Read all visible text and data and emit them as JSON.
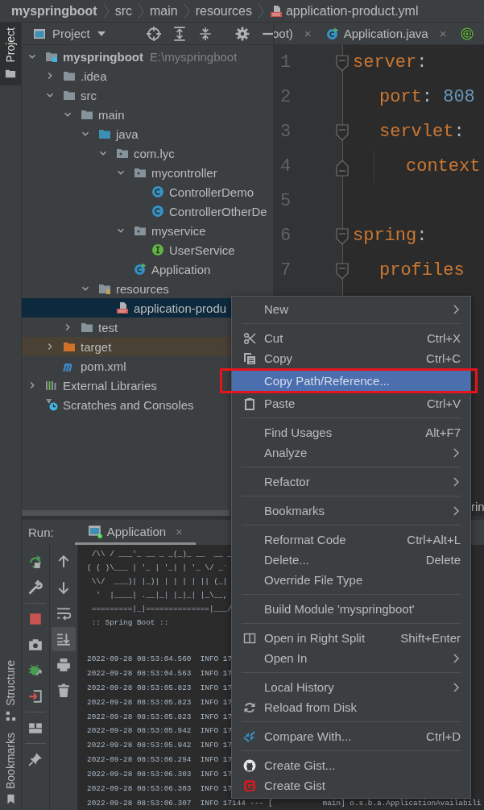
{
  "breadcrumbs": [
    {
      "label": "myspringboot",
      "kind": "project"
    },
    {
      "label": "src",
      "kind": "folder"
    },
    {
      "label": "main",
      "kind": "folder"
    },
    {
      "label": "resources",
      "kind": "folder"
    },
    {
      "label": "application-product.yml",
      "kind": "yml"
    }
  ],
  "tool_strip": {
    "top": [
      {
        "label": "Project",
        "selected": true
      }
    ],
    "bottom": [
      {
        "label": "Structure",
        "kind": "structure"
      },
      {
        "label": "Bookmarks",
        "kind": "bookmarks"
      }
    ]
  },
  "project_panel": {
    "title": "Project",
    "tree": [
      {
        "label": "myspringboot",
        "kind": "module",
        "hint": "E:\\myspringboot",
        "expanded": true,
        "selected": false,
        "children": [
          {
            "label": ".idea",
            "kind": "folder",
            "expanded": false,
            "selected": false
          },
          {
            "label": "src",
            "kind": "folder",
            "expanded": true,
            "selected": false,
            "children": [
              {
                "label": "main",
                "kind": "folder",
                "expanded": true,
                "selected": false,
                "children": [
                  {
                    "label": "java",
                    "kind": "source-folder",
                    "expanded": true,
                    "selected": false,
                    "children": [
                      {
                        "label": "com.lyc",
                        "kind": "package",
                        "expanded": true,
                        "selected": false,
                        "children": [
                          {
                            "label": "mycontroller",
                            "kind": "package",
                            "expanded": true,
                            "selected": false,
                            "children": [
                              {
                                "label": "ControllerDemo",
                                "kind": "class",
                                "selected": false
                              },
                              {
                                "label": "ControllerOtherDe",
                                "kind": "class",
                                "selected": false
                              }
                            ]
                          },
                          {
                            "label": "myservice",
                            "kind": "package",
                            "expanded": true,
                            "selected": false,
                            "children": [
                              {
                                "label": "UserService",
                                "kind": "interface",
                                "selected": false
                              }
                            ]
                          },
                          {
                            "label": "Application",
                            "kind": "main-class",
                            "selected": false
                          }
                        ]
                      }
                    ]
                  },
                  {
                    "label": "resources",
                    "kind": "resource-folder",
                    "expanded": true,
                    "selected": false,
                    "children": [
                      {
                        "label": "application-produ",
                        "kind": "yml",
                        "selected": true
                      }
                    ]
                  }
                ]
              },
              {
                "label": "test",
                "kind": "folder",
                "expanded": false,
                "selected": false
              }
            ]
          },
          {
            "label": "target",
            "kind": "excluded-folder",
            "expanded": false,
            "selected": false
          },
          {
            "label": "pom.xml",
            "kind": "maven",
            "selected": false
          }
        ]
      },
      {
        "label": "External Libraries",
        "kind": "libraries",
        "expanded": false,
        "selected": false
      },
      {
        "label": "Scratches and Consoles",
        "kind": "scratches",
        "selected": false
      }
    ]
  },
  "editor": {
    "tabs": [
      {
        "label": "oot)",
        "kind": "plain",
        "close": "×"
      },
      {
        "label": "Application.java",
        "kind": "main-class",
        "close": "×"
      },
      {
        "kind": "annotation"
      }
    ],
    "lines": [
      {
        "number": "1",
        "kind": "fold-start",
        "key": "server",
        "colon": ":",
        "children": [
          {
            "number": "2",
            "kind": "plain",
            "key": "port",
            "colon": ":",
            "value": "808"
          },
          {
            "number": "3",
            "kind": "fold-start",
            "key": "servlet",
            "colon": ":",
            "children": [
              {
                "number": "4",
                "kind": "fold-end",
                "key": "context"
              }
            ]
          }
        ]
      },
      {
        "number": "5",
        "kind": "plain"
      },
      {
        "number": "6",
        "kind": "fold-start",
        "key": "spring",
        "colon": ":",
        "children": [
          {
            "number": "7",
            "kind": "fold-start",
            "key": "profiles"
          }
        ]
      }
    ]
  },
  "side_fragment": "rin",
  "run_panel": {
    "title": "Run:",
    "tab": {
      "label": "Application",
      "close": "×",
      "selected": true
    },
    "tools_left": [
      {
        "kind": "rerun"
      },
      {
        "kind": "wrench"
      },
      {
        "kind": "separator"
      },
      {
        "kind": "stop"
      },
      {
        "kind": "camera"
      },
      {
        "kind": "bug"
      },
      {
        "kind": "exit"
      },
      {
        "kind": "separator"
      },
      {
        "kind": "layout"
      },
      {
        "kind": "separator"
      },
      {
        "kind": "pin"
      }
    ],
    "tools_right": [
      {
        "kind": "up",
        "on": false
      },
      {
        "kind": "down",
        "on": false
      },
      {
        "kind": "wrap",
        "on": false
      },
      {
        "kind": "scroll-end",
        "on": true
      },
      {
        "kind": "print",
        "on": false
      },
      {
        "kind": "trash",
        "on": false
      }
    ],
    "banner": [
      " /\\\\ / ___'_ __ _ _(_)_ __  __ _",
      "( ( )\\___ | '_ | '_| | '_ \\/ _`",
      " \\\\/  ___)| |_)| | | | | || (_|",
      "  '  |____| .__|_| |_|_| |_\\__,",
      " =========|_|==============|___/",
      " :: Spring Boot ::"
    ],
    "log": [
      "2022-09-28 08:53:04.560  INFO 17",
      "2022-09-28 08:53:04.563  INFO 17",
      "2022-09-28 08:53:05.823  INFO 17",
      "2022-09-28 08:53:05.823  INFO 17",
      "2022-09-28 08:53:05.823  INFO 17",
      "2022-09-28 08:53:05.942  INFO 17",
      "2022-09-28 08:53:05.942  INFO 17",
      "2022-09-28 08:53:06.294  INFO 17",
      "2022-09-28 08:53:06.303  INFO 17",
      "2022-09-28 08:53:06.303  INFO 17",
      "2022-09-28 08:53:06.307  INFO 17144 --- [           main] o.s.b.a.ApplicationAvailabili"
    ]
  },
  "context_menu": {
    "entries": [
      {
        "kind": "item",
        "label": "New",
        "submenu": true,
        "selected": false,
        "marked": false
      },
      {
        "kind": "separator"
      },
      {
        "kind": "cut",
        "label": "Cut",
        "shortcut": "Ctrl+X",
        "submenu": false,
        "selected": false,
        "marked": false
      },
      {
        "kind": "copy",
        "label": "Copy",
        "shortcut": "Ctrl+C",
        "submenu": false,
        "selected": false,
        "marked": false
      },
      {
        "kind": "item",
        "label": "Copy Path/Reference...",
        "submenu": false,
        "selected": true,
        "marked": true
      },
      {
        "kind": "paste",
        "label": "Paste",
        "shortcut": "Ctrl+V",
        "submenu": false,
        "selected": false,
        "marked": false
      },
      {
        "kind": "separator"
      },
      {
        "kind": "item",
        "label": "Find Usages",
        "shortcut": "Alt+F7",
        "submenu": false,
        "selected": false,
        "marked": false
      },
      {
        "kind": "item",
        "label": "Analyze",
        "submenu": true,
        "selected": false,
        "marked": false
      },
      {
        "kind": "separator"
      },
      {
        "kind": "item",
        "label": "Refactor",
        "submenu": true,
        "selected": false,
        "marked": false
      },
      {
        "kind": "separator"
      },
      {
        "kind": "item",
        "label": "Bookmarks",
        "submenu": true,
        "selected": false,
        "marked": false
      },
      {
        "kind": "separator"
      },
      {
        "kind": "item",
        "label": "Reformat Code",
        "shortcut": "Ctrl+Alt+L",
        "submenu": false,
        "selected": false,
        "marked": false
      },
      {
        "kind": "item",
        "label": "Delete...",
        "shortcut": "Delete",
        "submenu": false,
        "selected": false,
        "marked": false
      },
      {
        "kind": "item",
        "label": "Override File Type",
        "submenu": false,
        "selected": false,
        "marked": false
      },
      {
        "kind": "separator"
      },
      {
        "kind": "item",
        "label": "Build Module 'myspringboot'",
        "submenu": false,
        "selected": false,
        "marked": false
      },
      {
        "kind": "separator"
      },
      {
        "kind": "split",
        "label": "Open in Right Split",
        "shortcut": "Shift+Enter",
        "submenu": false,
        "selected": false,
        "marked": false
      },
      {
        "kind": "item",
        "label": "Open In",
        "submenu": true,
        "selected": false,
        "marked": false
      },
      {
        "kind": "separator"
      },
      {
        "kind": "item",
        "label": "Local History",
        "submenu": true,
        "selected": false,
        "marked": false
      },
      {
        "kind": "reload",
        "label": "Reload from Disk",
        "submenu": false,
        "selected": false,
        "marked": false
      },
      {
        "kind": "separator"
      },
      {
        "kind": "compare",
        "label": "Compare With...",
        "shortcut": "Ctrl+D",
        "submenu": false,
        "selected": false,
        "marked": false
      },
      {
        "kind": "separator"
      },
      {
        "kind": "cat",
        "label": "Create Gist...",
        "submenu": false,
        "selected": false,
        "marked": false
      },
      {
        "kind": "gitee",
        "label": "Create Gist",
        "submenu": false,
        "selected": false,
        "marked": false
      }
    ]
  }
}
